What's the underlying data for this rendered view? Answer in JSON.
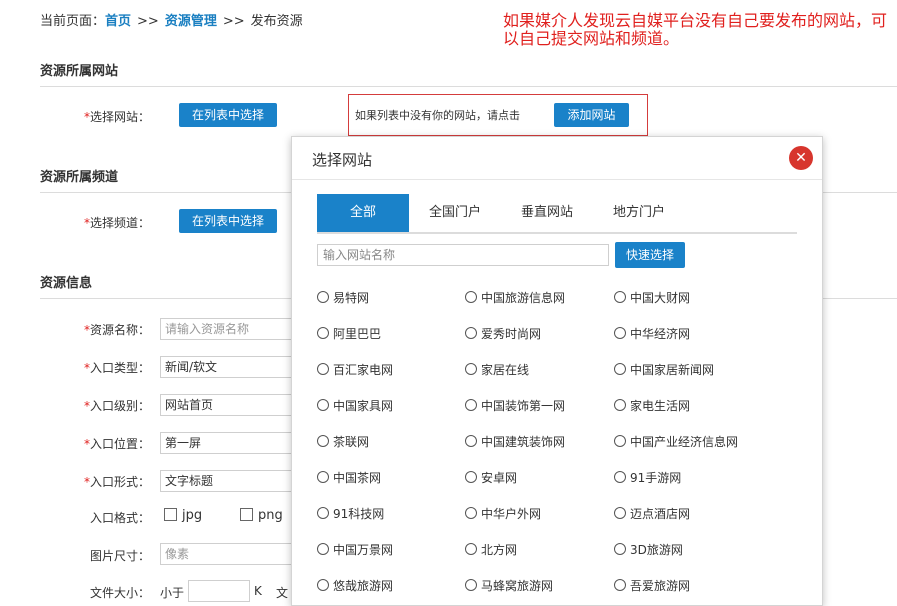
{
  "breadcrumb": {
    "prefix": "当前页面：",
    "home": "首页",
    "sep1": ">>",
    "resource": "资源管理",
    "sep2": ">>",
    "current": "发布资源"
  },
  "annotation": "如果媒介人发现云自媒平台没有自己要发布的网站，可以自己提交网站和频道。",
  "sections": {
    "website": "资源所属网站",
    "channel": "资源所属频道",
    "info": "资源信息"
  },
  "form": {
    "select_site_label": "*选择网站：",
    "select_channel_label": "*选择频道：",
    "choose_from_list": "在列表中选择",
    "hint_text": "如果列表中没有你的网站，请点击",
    "add_site": "添加网站",
    "rows": [
      {
        "label": "*资源名称：",
        "value": "请输入资源名称",
        "placeholder": true
      },
      {
        "label": "*入口类型：",
        "value": "新闻/软文",
        "placeholder": false
      },
      {
        "label": "*入口级别：",
        "value": "网站首页",
        "placeholder": false
      },
      {
        "label": "*入口位置：",
        "value": "第一屏",
        "placeholder": false
      },
      {
        "label": "*入口形式：",
        "value": "文字标题",
        "placeholder": false
      }
    ],
    "format_label": "入口格式：",
    "format_options": [
      "jpg",
      "png"
    ],
    "size_label": "图片尺寸：",
    "size_placeholder": "像素",
    "filesize_label": "文件大小：",
    "filesize_prefix": "小于",
    "filesize_unit": "K",
    "filesize_extra": "文"
  },
  "modal": {
    "title": "选择网站",
    "close_icon": "close-icon",
    "tabs": [
      "全部",
      "全国门户",
      "垂直网站",
      "地方门户"
    ],
    "active_tab": 0,
    "search_placeholder": "输入网站名称",
    "quick_select": "快速选择",
    "sites": [
      "易特网",
      "中国旅游信息网",
      "中国大财网",
      "阿里巴巴",
      "爱秀时尚网",
      "中华经济网",
      "百汇家电网",
      "家居在线",
      "中国家居新闻网",
      "中国家具网",
      "中国装饰第一网",
      "家电生活网",
      "茶联网",
      "中国建筑装饰网",
      "中国产业经济信息网",
      "中国茶网",
      "安卓网",
      "91手游网",
      "91科技网",
      "中华户外网",
      "迈点酒店网",
      "中国万景网",
      "北方网",
      "3D旅游网",
      "悠哉旅游网",
      "马蜂窝旅游网",
      "吾爱旅游网"
    ]
  },
  "colors": {
    "accent": "#1a82c9",
    "link": "#1a7fc1",
    "required": "#e0201e",
    "close": "#d7352d"
  }
}
